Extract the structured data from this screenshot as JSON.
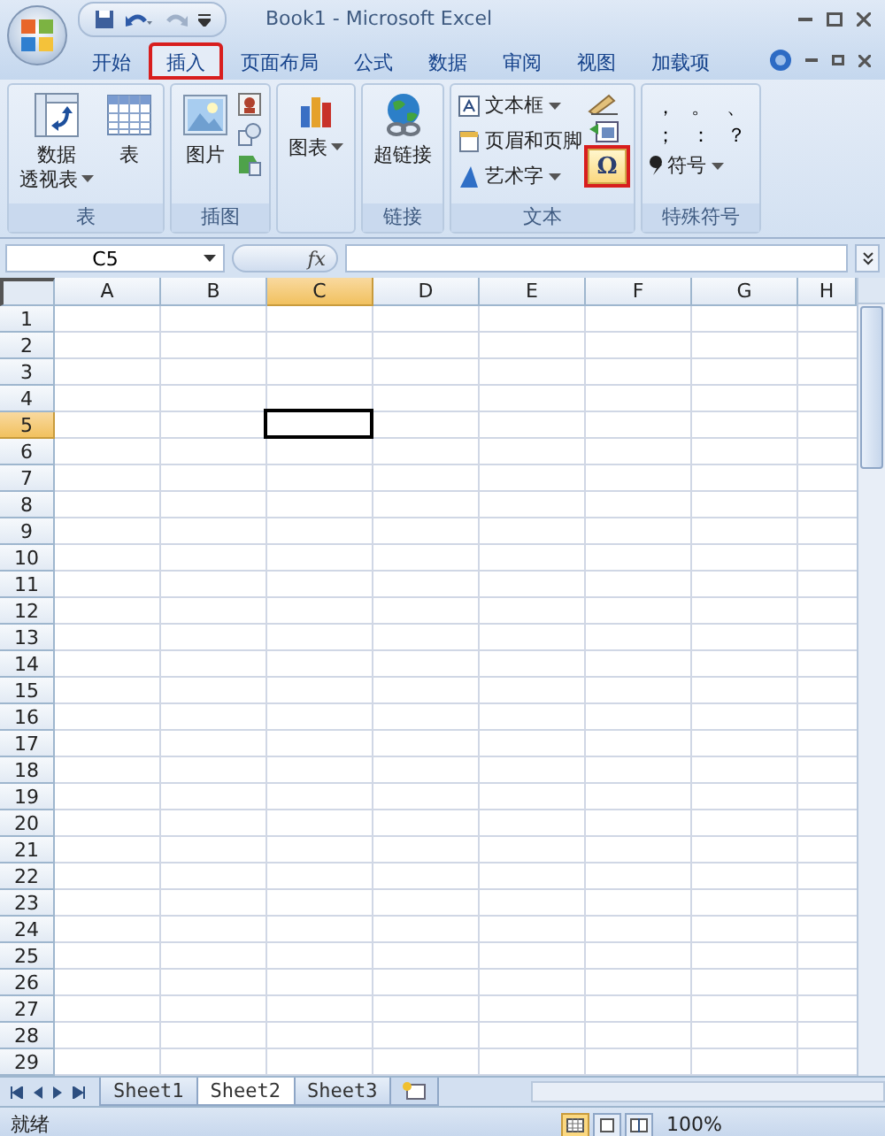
{
  "window": {
    "title": "Book1 - Microsoft Excel"
  },
  "tabs": [
    {
      "label": "开始",
      "selected": false,
      "highlighted": false
    },
    {
      "label": "插入",
      "selected": true,
      "highlighted": true
    },
    {
      "label": "页面布局",
      "selected": false,
      "highlighted": false
    },
    {
      "label": "公式",
      "selected": false,
      "highlighted": false
    },
    {
      "label": "数据",
      "selected": false,
      "highlighted": false
    },
    {
      "label": "审阅",
      "selected": false,
      "highlighted": false
    },
    {
      "label": "视图",
      "selected": false,
      "highlighted": false
    },
    {
      "label": "加载项",
      "selected": false,
      "highlighted": false
    }
  ],
  "ribbon_groups": [
    {
      "label": "表",
      "items": [
        {
          "kind": "large",
          "label_lines": [
            "数据",
            "透视表"
          ],
          "dropdown": true,
          "highlighted": false
        },
        {
          "kind": "large",
          "label_lines": [
            "表"
          ],
          "dropdown": false,
          "highlighted": false
        }
      ]
    },
    {
      "label": "插图",
      "items": [
        {
          "kind": "large",
          "label_lines": [
            "图片"
          ],
          "dropdown": false,
          "highlighted": false
        },
        {
          "kind": "stack"
        }
      ]
    },
    {
      "items": [
        {
          "kind": "large",
          "label_lines": [
            "图表"
          ],
          "dropdown": true,
          "highlighted": false
        }
      ]
    },
    {
      "label": "链接",
      "items": [
        {
          "kind": "large",
          "label_lines": [
            "超链接"
          ],
          "dropdown": false,
          "highlighted": false
        }
      ]
    },
    {
      "label": "文本",
      "items": [
        {
          "kind": "list",
          "entries": [
            {
              "label": "文本框",
              "dropdown": true
            },
            {
              "label": "页眉和页脚",
              "dropdown": false
            },
            {
              "label": "艺术字",
              "dropdown": true
            }
          ]
        },
        {
          "kind": "symbol_stack",
          "symbol": "Ω",
          "highlighted": true
        }
      ]
    },
    {
      "label": "特殊符号",
      "items": [
        {
          "kind": "symbols",
          "symbols": [
            "，",
            "。",
            "、",
            "；",
            "：",
            "？"
          ],
          "menu_label": "符号",
          "dropdown": true
        }
      ]
    }
  ],
  "formula_bar": {
    "name_box": "C5",
    "fx": "fx"
  },
  "columns": [
    {
      "label": "A",
      "selected": false
    },
    {
      "label": "B",
      "selected": false
    },
    {
      "label": "C",
      "selected": true
    },
    {
      "label": "D",
      "selected": false
    },
    {
      "label": "E",
      "selected": false
    },
    {
      "label": "F",
      "selected": false
    },
    {
      "label": "G",
      "selected": false
    },
    {
      "label": "H",
      "selected": false
    }
  ],
  "rows": [
    {
      "label": "1",
      "selected": false
    },
    {
      "label": "2",
      "selected": false
    },
    {
      "label": "3",
      "selected": false
    },
    {
      "label": "4",
      "selected": false
    },
    {
      "label": "5",
      "selected": true
    },
    {
      "label": "6",
      "selected": false
    },
    {
      "label": "7",
      "selected": false
    },
    {
      "label": "8",
      "selected": false
    },
    {
      "label": "9",
      "selected": false
    },
    {
      "label": "10",
      "selected": false
    },
    {
      "label": "11",
      "selected": false
    },
    {
      "label": "12",
      "selected": false
    },
    {
      "label": "13",
      "selected": false
    },
    {
      "label": "14",
      "selected": false
    },
    {
      "label": "15",
      "selected": false
    },
    {
      "label": "16",
      "selected": false
    },
    {
      "label": "17",
      "selected": false
    },
    {
      "label": "18",
      "selected": false
    },
    {
      "label": "19",
      "selected": false
    },
    {
      "label": "20",
      "selected": false
    },
    {
      "label": "21",
      "selected": false
    },
    {
      "label": "22",
      "selected": false
    },
    {
      "label": "23",
      "selected": false
    },
    {
      "label": "24",
      "selected": false
    },
    {
      "label": "25",
      "selected": false
    },
    {
      "label": "26",
      "selected": false
    },
    {
      "label": "27",
      "selected": false
    },
    {
      "label": "28",
      "selected": false
    },
    {
      "label": "29",
      "selected": false
    }
  ],
  "sheets": [
    {
      "label": "Sheet1",
      "selected": false
    },
    {
      "label": "Sheet2",
      "selected": true
    },
    {
      "label": "Sheet3",
      "selected": false
    }
  ],
  "status_bar": {
    "text": "就绪",
    "views": [
      {
        "kind": "normal",
        "selected": true
      },
      {
        "kind": "layout",
        "selected": false
      },
      {
        "kind": "break",
        "selected": false
      }
    ],
    "zoom": "100%"
  }
}
